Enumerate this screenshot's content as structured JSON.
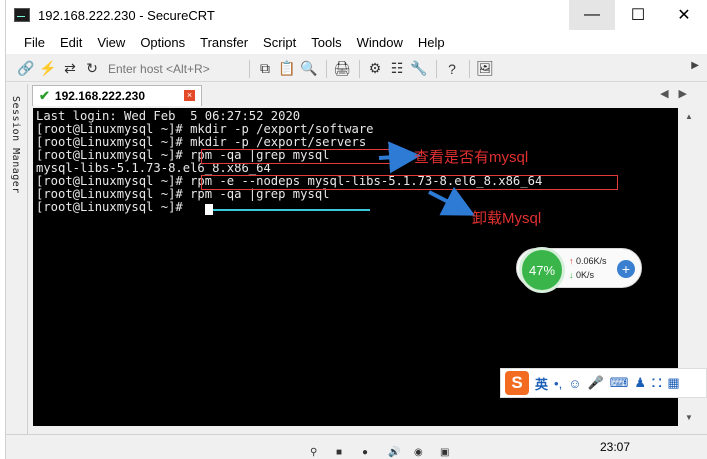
{
  "window": {
    "title": "192.168.222.230 - SecureCRT"
  },
  "menu": [
    "File",
    "Edit",
    "View",
    "Options",
    "Transfer",
    "Script",
    "Tools",
    "Window",
    "Help"
  ],
  "toolbar": {
    "host_placeholder": "Enter host <Alt+R>"
  },
  "session_manager": {
    "label": "Session Manager"
  },
  "tab": {
    "label": "192.168.222.230",
    "close": "×"
  },
  "terminal": {
    "lines": [
      "Last login: Wed Feb  5 06:27:52 2020",
      "[root@Linuxmysql ~]# mkdir -p /export/software",
      "[root@Linuxmysql ~]# mkdir -p /export/servers",
      "[root@Linuxmysql ~]# rpm -qa |grep mysql",
      "mysql-libs-5.1.73-8.el6_8.x86_64",
      "[root@Linuxmysql ~]# rpm -e --nodeps mysql-libs-5.1.73-8.el6_8.x86_64",
      "[root@Linuxmysql ~]# rpm -qa |grep mysql",
      "[root@Linuxmysql ~]# "
    ]
  },
  "annotations": {
    "check": "查看是否有mysql",
    "uninstall": "卸载Mysql"
  },
  "netmon": {
    "percent": "47%",
    "up": "0.06K/s",
    "down": "0K/s"
  },
  "ime": {
    "logo": "S",
    "lang": "英"
  },
  "clock": "23:07",
  "colors": {
    "annotation": "#e03030",
    "arrow": "#2e7bd6",
    "cursor_line": "#3cc8dc",
    "net_ok": "#3ab54a"
  }
}
